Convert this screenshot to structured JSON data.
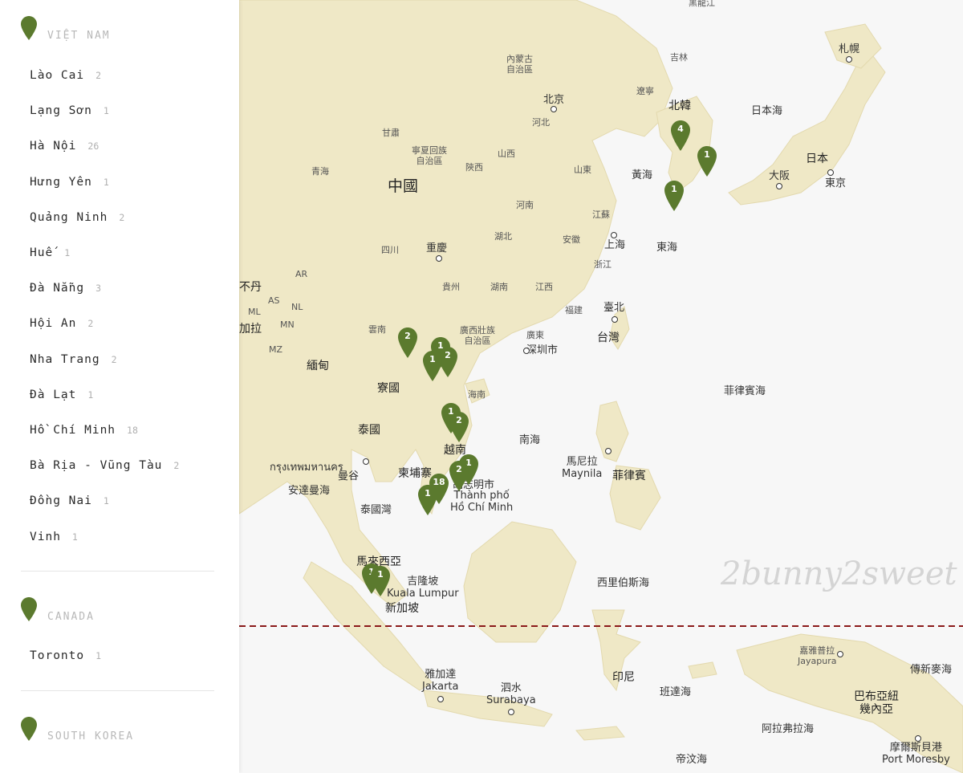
{
  "sidebar": {
    "sections": [
      {
        "country": "VIỆT NAM",
        "cities": [
          {
            "name": "Lào Cai",
            "count": "2"
          },
          {
            "name": "Lạng Sơn",
            "count": "1"
          },
          {
            "name": "Hà Nội",
            "count": "26"
          },
          {
            "name": "Hưng Yên",
            "count": "1"
          },
          {
            "name": "Quảng Ninh",
            "count": "2"
          },
          {
            "name": "Huế",
            "count": "1"
          },
          {
            "name": "Đà Nẵng",
            "count": "3"
          },
          {
            "name": "Hội An",
            "count": "2"
          },
          {
            "name": "Nha Trang",
            "count": "2"
          },
          {
            "name": "Đà Lạt",
            "count": "1"
          },
          {
            "name": "Hồ Chí Minh",
            "count": "18"
          },
          {
            "name": "Bà Rịa - Vũng Tàu",
            "count": "2"
          },
          {
            "name": "Đồng Nai",
            "count": "1"
          },
          {
            "name": "Vinh",
            "count": "1"
          }
        ]
      },
      {
        "country": "CANADA",
        "cities": [
          {
            "name": "Toronto",
            "count": "1"
          }
        ]
      },
      {
        "country": "SOUTH KOREA",
        "cities": []
      }
    ],
    "pin_color": "#5b7a2e"
  },
  "map": {
    "colors": {
      "land": "#efe8c6",
      "sea": "#f7f7f7",
      "marker": "#5b7a2e",
      "equator": "#8b1a1a"
    },
    "watermark": "2bunny2sweet",
    "labels": [
      {
        "t": "黑龍江",
        "c": "s"
      },
      {
        "t": "札幌",
        "c": "w"
      },
      {
        "t": "吉林",
        "c": "s"
      },
      {
        "t": "內蒙古\n自治區",
        "c": "s"
      },
      {
        "t": "北京",
        "c": "w"
      },
      {
        "t": "遼寧",
        "c": "s"
      },
      {
        "t": "北韓",
        "c": "m"
      },
      {
        "t": "日本海",
        "c": "w"
      },
      {
        "t": "河北",
        "c": "s"
      },
      {
        "t": "甘肅",
        "c": "s"
      },
      {
        "t": "寧夏回族\n自治區",
        "c": "s"
      },
      {
        "t": "山西",
        "c": "s"
      },
      {
        "t": "日本",
        "c": "m"
      },
      {
        "t": "大阪",
        "c": "w"
      },
      {
        "t": "東京",
        "c": "w"
      },
      {
        "t": "青海",
        "c": "s"
      },
      {
        "t": "陝西",
        "c": "s"
      },
      {
        "t": "山東",
        "c": "s"
      },
      {
        "t": "黃海",
        "c": "w"
      },
      {
        "t": "中國",
        "c": "l"
      },
      {
        "t": "河南",
        "c": "s"
      },
      {
        "t": "江蘇",
        "c": "s"
      },
      {
        "t": "四川",
        "c": "s"
      },
      {
        "t": "重慶",
        "c": "w"
      },
      {
        "t": "湖北",
        "c": "s"
      },
      {
        "t": "安徽",
        "c": "s"
      },
      {
        "t": "上海",
        "c": "w"
      },
      {
        "t": "東海",
        "c": "w"
      },
      {
        "t": "浙江",
        "c": "s"
      },
      {
        "t": "AR",
        "c": "s"
      },
      {
        "t": "不丹",
        "c": "m"
      },
      {
        "t": "AS",
        "c": "s"
      },
      {
        "t": "NL",
        "c": "s"
      },
      {
        "t": "ML",
        "c": "s"
      },
      {
        "t": "貴州",
        "c": "s"
      },
      {
        "t": "湖南",
        "c": "s"
      },
      {
        "t": "江西",
        "c": "s"
      },
      {
        "t": "福建",
        "c": "s"
      },
      {
        "t": "臺北",
        "c": "w"
      },
      {
        "t": "MN",
        "c": "s"
      },
      {
        "t": "加拉",
        "c": "m"
      },
      {
        "t": "雲南",
        "c": "s"
      },
      {
        "t": "廣西壯族\n自治區",
        "c": "s"
      },
      {
        "t": "廣東",
        "c": "s"
      },
      {
        "t": "台灣",
        "c": "m"
      },
      {
        "t": "MZ",
        "c": "s"
      },
      {
        "t": "深圳市",
        "c": "w"
      },
      {
        "t": "緬甸",
        "c": "m"
      },
      {
        "t": "寮國",
        "c": "m"
      },
      {
        "t": "海南",
        "c": "s"
      },
      {
        "t": "菲律賓海",
        "c": "w"
      },
      {
        "t": "泰國",
        "c": "m"
      },
      {
        "t": "越南",
        "c": "m"
      },
      {
        "t": "南海",
        "c": "w"
      },
      {
        "t": "曼谷",
        "c": "w"
      },
      {
        "t": "กรุงเทพมหานคร",
        "c": "w"
      },
      {
        "t": "馬尼拉\nMaynila",
        "c": "w"
      },
      {
        "t": "菲律賓",
        "c": "m"
      },
      {
        "t": "柬埔寨",
        "c": "m"
      },
      {
        "t": "胡志明市",
        "c": "w"
      },
      {
        "t": "Thành phố\nHồ Chí Minh",
        "c": "w"
      },
      {
        "t": "安達曼海",
        "c": "w"
      },
      {
        "t": "泰國灣",
        "c": "w"
      },
      {
        "t": "馬來西亞",
        "c": "m"
      },
      {
        "t": "吉隆坡\nKuala Lumpur",
        "c": "w"
      },
      {
        "t": "西里伯斯海",
        "c": "w"
      },
      {
        "t": "新加坡",
        "c": "m"
      },
      {
        "t": "嘉雅普拉\nJayapura",
        "c": "s"
      },
      {
        "t": "傳新麥海",
        "c": "w"
      },
      {
        "t": "雅加達\nJakarta",
        "c": "w"
      },
      {
        "t": "印尼",
        "c": "m"
      },
      {
        "t": "泗水\nSurabaya",
        "c": "w"
      },
      {
        "t": "班達海",
        "c": "w"
      },
      {
        "t": "巴布亞紐\n幾內亞",
        "c": "m"
      },
      {
        "t": "阿拉弗拉海",
        "c": "w"
      },
      {
        "t": "帝汶海",
        "c": "w"
      },
      {
        "t": "摩爾斯貝港\nPort Moresby",
        "c": "w"
      }
    ],
    "markers": [
      "4",
      "1",
      "1",
      "2",
      "1",
      "2",
      "1",
      "1",
      "2",
      "1",
      "2",
      "18",
      "1",
      "1",
      "1"
    ]
  }
}
